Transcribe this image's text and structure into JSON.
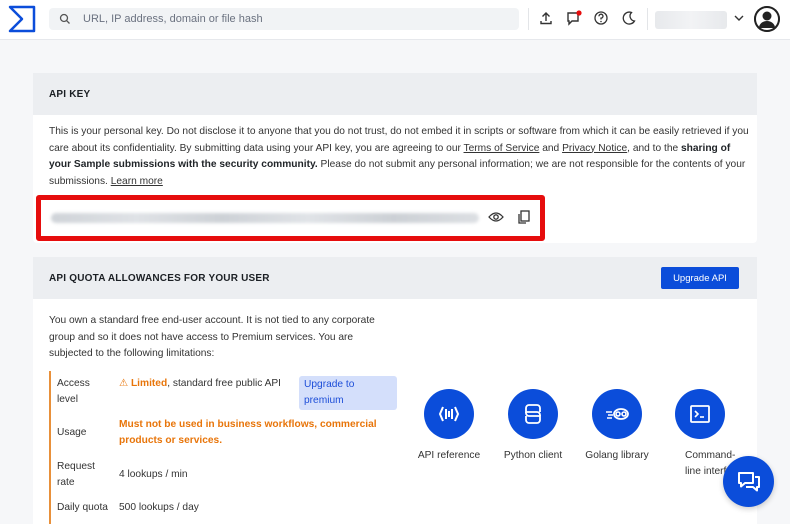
{
  "search": {
    "placeholder": "URL, IP address, domain or file hash"
  },
  "api_key": {
    "heading": "API KEY",
    "desc_part1": "This is your personal key. Do not disclose it to anyone that you do not trust, do not embed it in scripts or software from which it can be easily retrieved if you care about its confidentiality. By submitting data using your API key, you are agreeing to our ",
    "terms_link": "Terms of Service",
    "and_text": " and ",
    "privacy_link": "Privacy Notice",
    "desc_part2": ", and to the ",
    "bold_text": "sharing of your Sample submissions with the security community.",
    "desc_part3": " Please do not submit any personal information; we are not responsible for the contents of your submissions. ",
    "learn_more": "Learn more"
  },
  "quota": {
    "heading": "API QUOTA ALLOWANCES FOR YOUR USER",
    "upgrade_button": "Upgrade API",
    "desc": "You own a standard free end-user account. It is not tied to any corporate group and so it does not have access to Premium services. You are subjected to the following limitations:",
    "rows": [
      {
        "key": "Access level",
        "limited": "⚠ Limited",
        "value": ", standard free public API",
        "badge": "Upgrade to premium"
      },
      {
        "key": "Usage",
        "value": "Must not be used in business workflows, commercial products or services."
      },
      {
        "key": "Request rate",
        "value": "4 lookups / min"
      },
      {
        "key": "Daily quota",
        "value": "500 lookups / day"
      }
    ]
  },
  "tools": [
    {
      "label": "API reference",
      "icon": "api-icon"
    },
    {
      "label": "Python client",
      "icon": "python-icon"
    },
    {
      "label": "Golang library",
      "icon": "golang-icon"
    },
    {
      "label": "Command-line interface",
      "icon": "terminal-icon"
    }
  ],
  "colors": {
    "primary": "#0b4dda",
    "highlight": "#e60d0d",
    "warning": "#e8750a"
  }
}
